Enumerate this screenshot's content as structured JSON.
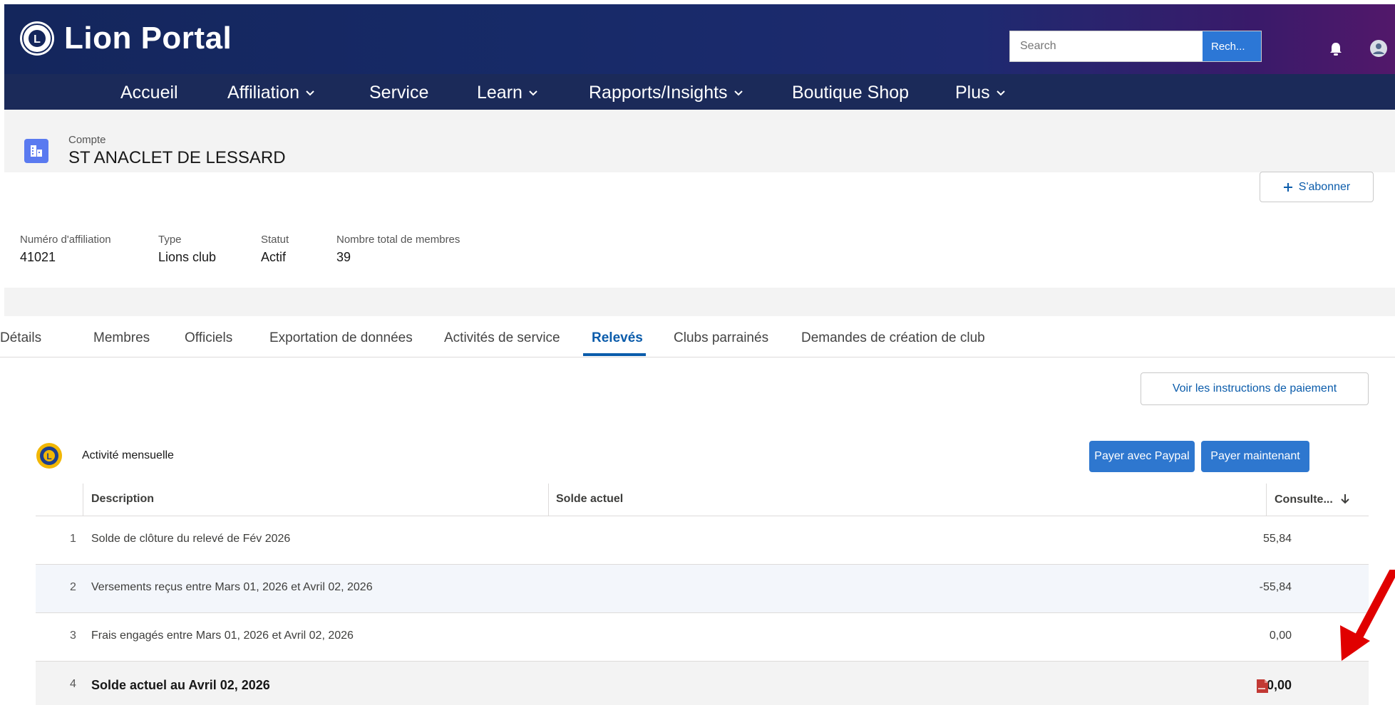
{
  "header": {
    "app_title": "Lion Portal",
    "search_placeholder": "Search",
    "search_button": "Rech..."
  },
  "nav": [
    {
      "label": "Accueil"
    },
    {
      "label": "Affiliation",
      "dropdown": true
    },
    {
      "label": "Service"
    },
    {
      "label": "Learn",
      "dropdown": true
    },
    {
      "label": "Rapports/Insights",
      "dropdown": true
    },
    {
      "label": "Boutique Shop"
    },
    {
      "label": "Plus",
      "dropdown": true
    }
  ],
  "record": {
    "object_label": "Compte",
    "name": "ST ANACLET DE LESSARD",
    "subscribe_label": "S'abonner"
  },
  "highlights": [
    {
      "label": "Numéro d'affiliation",
      "value": "41021"
    },
    {
      "label": "Type",
      "value": "Lions club"
    },
    {
      "label": "Statut",
      "value": "Actif"
    },
    {
      "label": "Nombre total de membres",
      "value": "39"
    }
  ],
  "tabs": [
    {
      "label": "Détails"
    },
    {
      "label": "Membres"
    },
    {
      "label": "Officiels"
    },
    {
      "label": "Exportation de données"
    },
    {
      "label": "Activités de service"
    },
    {
      "label": "Relevés",
      "active": true
    },
    {
      "label": "Clubs parrainés"
    },
    {
      "label": "Demandes de création de club"
    }
  ],
  "statements": {
    "instructions_button": "Voir les instructions de paiement",
    "card_title": "Activité mensuelle",
    "pay_paypal": "Payer avec Paypal",
    "pay_now": "Payer maintenant",
    "columns": {
      "description": "Description",
      "balance": "Solde actuel",
      "consult": "Consulte..."
    },
    "rows": [
      {
        "num": "1",
        "description": "Solde de clôture du relevé de Fév 2026",
        "balance": "55,84"
      },
      {
        "num": "2",
        "description": "Versements reçus entre Mars 01, 2026 et Avril 02, 2026",
        "balance": "-55,84"
      },
      {
        "num": "3",
        "description": "Frais engagés entre Mars 01, 2026 et Avril 02, 2026",
        "balance": "0,00"
      },
      {
        "num": "4",
        "description": "Solde actuel au Avril 02, 2026",
        "balance": "0,00",
        "has_pdf": true
      }
    ]
  },
  "colors": {
    "header_gradient_start": "#14265c",
    "header_gradient_end": "#52186a",
    "nav_bg": "#1b2a59",
    "accent": "#0b5cab",
    "button_blue": "#2e77cf",
    "annotation_arrow": "#e00000"
  }
}
